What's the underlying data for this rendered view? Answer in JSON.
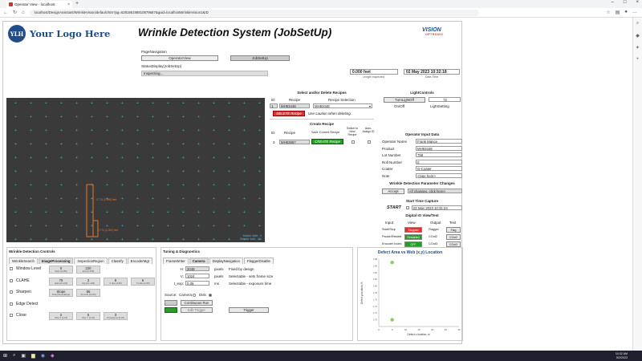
{
  "browser": {
    "tab_title": "Operator View - localhost",
    "url": "localhost/DesignAssistant/WrinkleVision/default.htm?pg=628186198810879687&guid=localhostWrinkleVision1&ID",
    "taskbar_time": "10:32 AM",
    "taskbar_date": "5/2/2023"
  },
  "header": {
    "logo_initials": "YLH",
    "logo_text": "Your Logo Here",
    "title": "Wrinkle Detection System (JobSetUp)",
    "brand": "VISION",
    "brand_sub": "OPTRONIX"
  },
  "page_nav": {
    "label": "PageNavigation",
    "operator_view": "OperatorView",
    "job_setup": "JobSetUp"
  },
  "status": {
    "label": "StatusDisplay(JobSetUp)",
    "value": "Inspecting..."
  },
  "length": {
    "value": "0.000 feet",
    "label": "Length Inspected"
  },
  "datetime": {
    "value": "02 May 2023 10:32:18",
    "label": "Date-Time"
  },
  "camera": {
    "status_line1": "Master Wait : 0",
    "status_line2": "Wrinkle Wait : 0.0",
    "detect_label1": "0.774 (0.998) feet",
    "detect_label2": "0.774 (1.000) feet"
  },
  "recipes": {
    "title": "Select and/or Delete Recipes",
    "id_header": "ID",
    "recipe_header": "Recipe",
    "selection_header": "Recipe Selection",
    "row_id": "1",
    "row_recipe": "MH93448",
    "row_selection": "MH93448",
    "delete_btn": "DELETE Recipe",
    "caution": "Use caution when deleting.",
    "create_title": "Create Recipe",
    "recipe_col": "Recipe",
    "save_current": "Save Current Recipe",
    "switch_new": "Switch to New Recipe",
    "auto_assign": "Auto-Assign ID",
    "create_id": "3",
    "create_recipe": "MH93957",
    "create_btn": "CREATE Recipe"
  },
  "lights": {
    "title": "LightControls",
    "turn_off": "TurnLightOff",
    "value": "72",
    "state": "On/Off",
    "setting": "LightSetting"
  },
  "operator": {
    "title": "Operator Input Data",
    "fields": [
      {
        "label": "Operator Name",
        "value": "Frank Mance"
      },
      {
        "label": "Product",
        "value": "MH93448"
      },
      {
        "label": "Lot Number",
        "value": "759"
      },
      {
        "label": "Roll Number",
        "value": "0"
      },
      {
        "label": "Coater",
        "value": "Q-Coater"
      },
      {
        "label": "Note",
        "value": "<type here>"
      }
    ]
  },
  "param_changes": {
    "title": "Wrinkle Detection Parameter Changes",
    "accept": "Accept",
    "value": "<if changes, click here>"
  },
  "start_time": {
    "title": "Start Time Capture",
    "start": "START",
    "value": "02 May 2023 10:31:24"
  },
  "digital_io": {
    "title": "Digital IO View/Test",
    "headers": [
      "Input",
      "View",
      "Output",
      "Test"
    ],
    "rows": [
      {
        "input": "Start/Stop",
        "view": "Stopped",
        "output": "Flagger",
        "test": "Flag"
      },
      {
        "input": "Pause/Restart",
        "view": "Restarted",
        "output": "COut2",
        "test": "COut2"
      },
      {
        "input": "Encoder Index",
        "view": "OFF",
        "output": "COut3",
        "test": "COut3"
      }
    ]
  },
  "wrinkle_controls": {
    "title": "Wrinkle Detection Controls",
    "tabs": [
      "WrinkleSearch",
      "ImageProcessing",
      "InspectionRegion",
      "Classify",
      "EncoderMgt"
    ],
    "rows": [
      {
        "label": "Window Level",
        "boxes": [
          {
            "v": "0",
            "l": "Start [0,255]"
          },
          {
            "v": "220",
            "l": "End [0,255]"
          }
        ]
      },
      {
        "label": "CLAHE",
        "boxes": [
          {
            "v": "75",
            "l": "alpha [0,100]"
          },
          {
            "v": "3",
            "l": "clip [0.1,100]"
          },
          {
            "v": "8",
            "l": "X tiles [2,50]"
          },
          {
            "v": "6",
            "l": "Ys tiles [2,50]"
          }
        ]
      },
      {
        "label": "Sharpen",
        "boxes": [
          {
            "v": "Slope",
            "l": "Filter[Slope|Edge]"
          },
          {
            "v": "56",
            "l": "Smooth [0,100]"
          }
        ]
      },
      {
        "label": "Edge Detect",
        "boxes": []
      },
      {
        "label": "Close",
        "boxes": [
          {
            "v": "2",
            "l": "Size X [1,15]"
          },
          {
            "v": "5",
            "l": "Size Y [1,15]"
          },
          {
            "v": "3",
            "l": "# Iterations [0,20]"
          }
        ]
      }
    ]
  },
  "tuning": {
    "title": "Tuning & Diagnostics",
    "tabs": [
      "FrameWriter",
      "Camera",
      "DisplayNavigation",
      "FlaggerDisable"
    ],
    "fields": [
      {
        "label": "H:",
        "value": "2048",
        "unit": "pixels",
        "desc": "Fixed by design"
      },
      {
        "label": "V:",
        "value": "1024",
        "unit": "pixels",
        "desc": "Selectable - sets frame size"
      },
      {
        "label": "t_exp:",
        "value": "0.05",
        "unit": "ms",
        "desc": "Selectable - exposure time"
      }
    ],
    "source_label": "Source:",
    "src_camera": "Camera",
    "src_disk": "Disk",
    "continuous_run": "Continuous Run",
    "edit_trigger": "Edit Trigger",
    "trigger": "Trigger"
  },
  "chart_data": {
    "type": "scatter",
    "title": "Defect Area vs Web (x,y) Location",
    "xlabel": "Defect x-location, in.",
    "ylabel": "Defect y-location, ft.",
    "xlim": [
      0,
      30
    ],
    "ylim": [
      1.68,
      1.88
    ],
    "xticks": [
      "0",
      "5",
      "10",
      "15",
      "20",
      "25",
      "30"
    ],
    "yticks": [
      "1.70",
      "1.72",
      "1.74",
      "1.76",
      "1.78",
      "1.80",
      "1.82",
      "1.84",
      "1.86",
      "1.88"
    ],
    "points": [
      {
        "x": 5,
        "y": 1.87
      },
      {
        "x": 5,
        "y": 1.7
      }
    ],
    "point_color": "#88cc66"
  }
}
